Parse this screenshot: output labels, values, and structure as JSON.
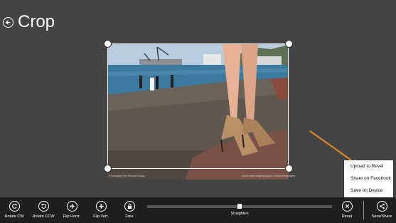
{
  "header": {
    "title": "Crop",
    "back_icon": "back-arrow-icon"
  },
  "photo": {
    "credit_left": "Photograph by Nevzat Sarac",
    "credit_right": "www.nationalgeographic.com/photography"
  },
  "context_menu": {
    "items": [
      {
        "label": "Upload to Revel"
      },
      {
        "label": "Share on Facebook"
      },
      {
        "label": "Save on Device"
      }
    ]
  },
  "toolbar": {
    "rotate_cw": "Rotate CW",
    "rotate_ccw": "Rotate CCW",
    "flip_horiz": "Flip Horiz.",
    "flip_vert": "Flip Vert.",
    "free": "Free",
    "straighten": "Straighten",
    "straighten_value": 0.5,
    "reset": "Reset",
    "save_share": "Save/Share"
  },
  "colors": {
    "background": "#444444",
    "app_bar": "#1f1f1f",
    "annotation_arrow": "#e08a2a"
  }
}
